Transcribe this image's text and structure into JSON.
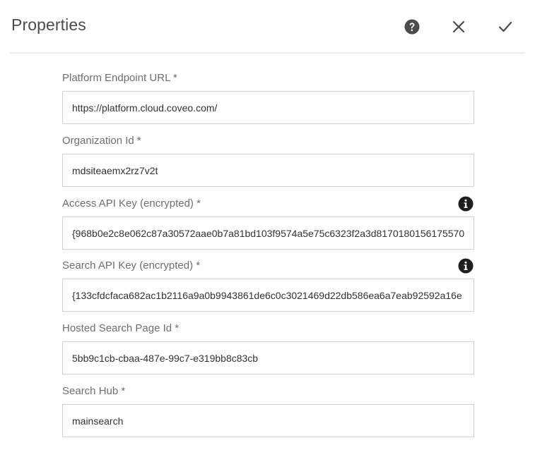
{
  "dialog": {
    "title": "Properties"
  },
  "header": {
    "icons": [
      "help-icon",
      "close-icon",
      "checkmark-icon"
    ]
  },
  "fields": [
    {
      "label": "Platform Endpoint URL *",
      "value": "https://platform.cloud.coveo.com/",
      "info": false
    },
    {
      "label": "Organization Id *",
      "value": "mdsiteaemx2rz7v2t",
      "info": false
    },
    {
      "label": "Access API Key (encrypted) *",
      "value": "{968b0e2c8e062c87a30572aae0b7a81bd103f9574a5e75c6323f2a3d8170180156175570",
      "info": true
    },
    {
      "label": "Search API Key (encrypted) *",
      "value": "{133cfdcfaca682ac1b2116a9a0b9943861de6c0c3021469d22db586ea6a7eab92592a16e",
      "info": true
    },
    {
      "label": "Hosted Search Page Id *",
      "value": "5bb9c1cb-cbaa-487e-99c7-e319bb8c83cb",
      "info": false
    },
    {
      "label": "Search Hub *",
      "value": "mainsearch",
      "info": false
    }
  ],
  "colors": {
    "title": "#4b4b4b",
    "label": "#6e6e6e",
    "border": "#d3d3d3",
    "icon": "#4b4b4b"
  }
}
